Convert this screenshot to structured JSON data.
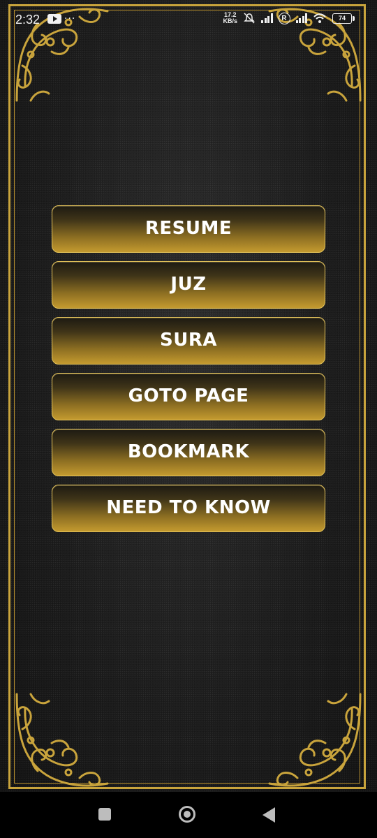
{
  "status_bar": {
    "time": "2:32",
    "more": "···",
    "net_speed_value": "17.2",
    "net_speed_unit": "KB/s",
    "roaming": "R",
    "battery": "74",
    "icons": [
      "youtube-icon",
      "mute-icon",
      "signal-icon",
      "roaming-icon",
      "signal-icon",
      "wifi-icon",
      "battery-icon"
    ]
  },
  "menu": {
    "items": [
      {
        "label": "RESUME"
      },
      {
        "label": "JUZ"
      },
      {
        "label": "SURA"
      },
      {
        "label": "GOTO PAGE"
      },
      {
        "label": "BOOKMARK"
      },
      {
        "label": "NEED TO KNOW"
      }
    ]
  },
  "nav_bar": {
    "icons": [
      "recents-icon",
      "home-icon",
      "back-icon"
    ]
  },
  "colors": {
    "gold": "#c9a43c",
    "gold_light": "#e4c35a",
    "background": "#1c1c1c"
  }
}
